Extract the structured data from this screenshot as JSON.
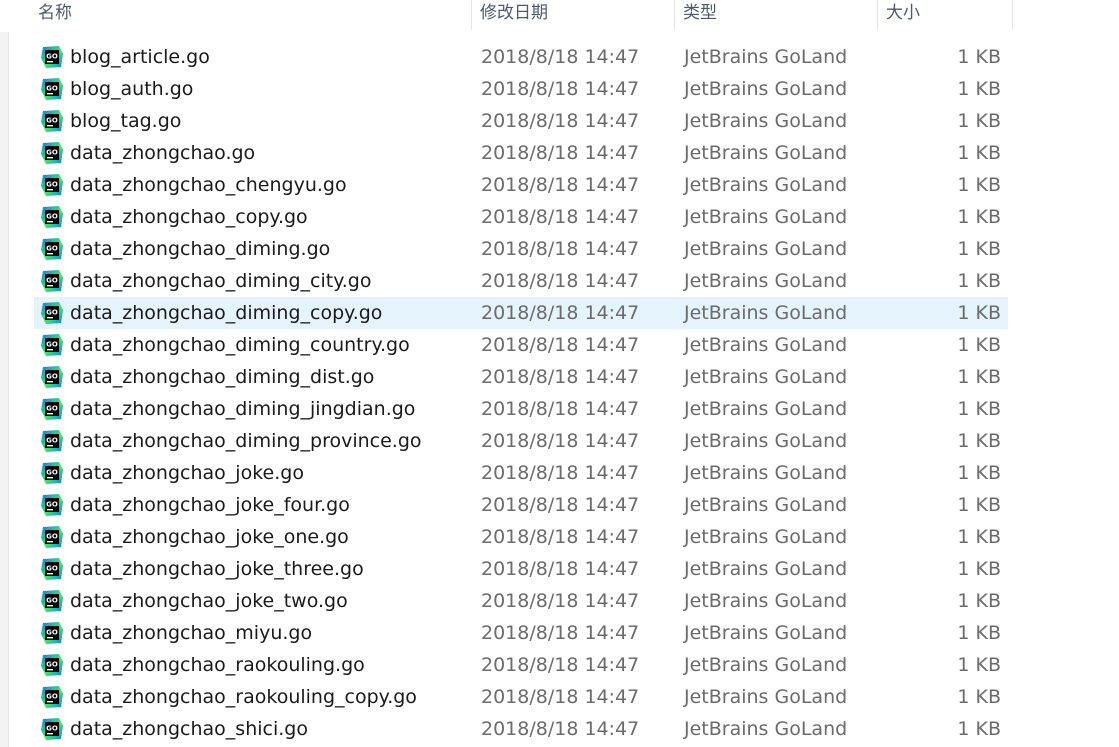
{
  "header": {
    "name": "名称",
    "date": "修改日期",
    "type": "类型",
    "size": "大小"
  },
  "files": [
    {
      "name": "blog_article.go",
      "date": "2018/8/18 14:47",
      "type": "JetBrains GoLand",
      "size": "1 KB"
    },
    {
      "name": "blog_auth.go",
      "date": "2018/8/18 14:47",
      "type": "JetBrains GoLand",
      "size": "1 KB"
    },
    {
      "name": "blog_tag.go",
      "date": "2018/8/18 14:47",
      "type": "JetBrains GoLand",
      "size": "1 KB"
    },
    {
      "name": "data_zhongchao.go",
      "date": "2018/8/18 14:47",
      "type": "JetBrains GoLand",
      "size": "1 KB"
    },
    {
      "name": "data_zhongchao_chengyu.go",
      "date": "2018/8/18 14:47",
      "type": "JetBrains GoLand",
      "size": "1 KB"
    },
    {
      "name": "data_zhongchao_copy.go",
      "date": "2018/8/18 14:47",
      "type": "JetBrains GoLand",
      "size": "1 KB"
    },
    {
      "name": "data_zhongchao_diming.go",
      "date": "2018/8/18 14:47",
      "type": "JetBrains GoLand",
      "size": "1 KB"
    },
    {
      "name": "data_zhongchao_diming_city.go",
      "date": "2018/8/18 14:47",
      "type": "JetBrains GoLand",
      "size": "1 KB"
    },
    {
      "name": "data_zhongchao_diming_copy.go",
      "date": "2018/8/18 14:47",
      "type": "JetBrains GoLand",
      "size": "1 KB",
      "selected": true
    },
    {
      "name": "data_zhongchao_diming_country.go",
      "date": "2018/8/18 14:47",
      "type": "JetBrains GoLand",
      "size": "1 KB"
    },
    {
      "name": "data_zhongchao_diming_dist.go",
      "date": "2018/8/18 14:47",
      "type": "JetBrains GoLand",
      "size": "1 KB"
    },
    {
      "name": "data_zhongchao_diming_jingdian.go",
      "date": "2018/8/18 14:47",
      "type": "JetBrains GoLand",
      "size": "1 KB"
    },
    {
      "name": "data_zhongchao_diming_province.go",
      "date": "2018/8/18 14:47",
      "type": "JetBrains GoLand",
      "size": "1 KB"
    },
    {
      "name": "data_zhongchao_joke.go",
      "date": "2018/8/18 14:47",
      "type": "JetBrains GoLand",
      "size": "1 KB"
    },
    {
      "name": "data_zhongchao_joke_four.go",
      "date": "2018/8/18 14:47",
      "type": "JetBrains GoLand",
      "size": "1 KB"
    },
    {
      "name": "data_zhongchao_joke_one.go",
      "date": "2018/8/18 14:47",
      "type": "JetBrains GoLand",
      "size": "1 KB"
    },
    {
      "name": "data_zhongchao_joke_three.go",
      "date": "2018/8/18 14:47",
      "type": "JetBrains GoLand",
      "size": "1 KB"
    },
    {
      "name": "data_zhongchao_joke_two.go",
      "date": "2018/8/18 14:47",
      "type": "JetBrains GoLand",
      "size": "1 KB"
    },
    {
      "name": "data_zhongchao_miyu.go",
      "date": "2018/8/18 14:47",
      "type": "JetBrains GoLand",
      "size": "1 KB"
    },
    {
      "name": "data_zhongchao_raokouling.go",
      "date": "2018/8/18 14:47",
      "type": "JetBrains GoLand",
      "size": "1 KB"
    },
    {
      "name": "data_zhongchao_raokouling_copy.go",
      "date": "2018/8/18 14:47",
      "type": "JetBrains GoLand",
      "size": "1 KB"
    },
    {
      "name": "data_zhongchao_shici.go",
      "date": "2018/8/18 14:47",
      "type": "JetBrains GoLand",
      "size": "1 KB"
    }
  ],
  "icon": {
    "name": "goland-file-icon",
    "label": "GO",
    "colors": {
      "gradient_a": "#0d7bf7",
      "gradient_b": "#3bea62",
      "gradient_c": "#087cfa",
      "core": "#000000",
      "label": "#ffffff"
    }
  },
  "colors": {
    "selection": "#e5f3fd",
    "header_text": "#4d5a6b",
    "meta_text": "#6b6b6b"
  }
}
